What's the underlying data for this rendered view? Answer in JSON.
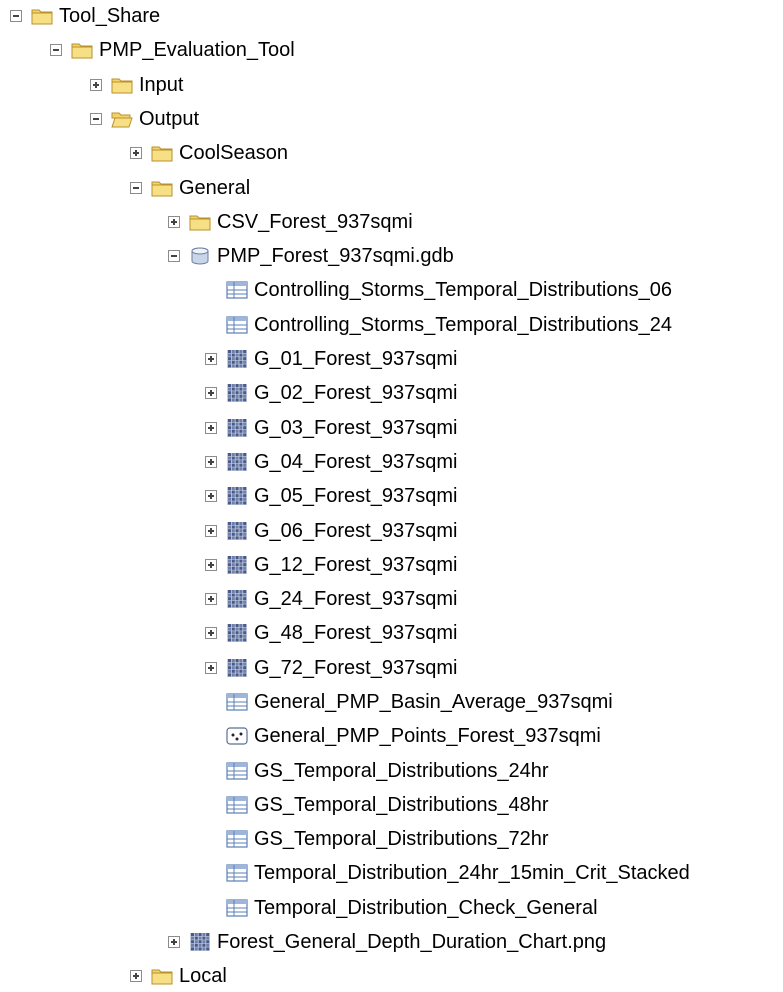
{
  "tree": {
    "partial_top_item": "Tool_Share",
    "items": [
      {
        "label": "Tool_Share",
        "icon": "folder-icon",
        "toggle": "minus"
      },
      {
        "label": "PMP_Evaluation_Tool",
        "icon": "folder-icon",
        "toggle": "minus"
      },
      {
        "label": "Input",
        "icon": "folder-icon",
        "toggle": "plus"
      },
      {
        "label": "Output",
        "icon": "folder-open-icon",
        "toggle": "minus"
      },
      {
        "label": "CoolSeason",
        "icon": "folder-icon",
        "toggle": "plus"
      },
      {
        "label": "General",
        "icon": "folder-icon",
        "toggle": "minus"
      },
      {
        "label": "CSV_Forest_937sqmi",
        "icon": "folder-icon",
        "toggle": "plus"
      },
      {
        "label": "PMP_Forest_937sqmi.gdb",
        "icon": "geodatabase-icon",
        "toggle": "minus"
      },
      {
        "label": "Controlling_Storms_Temporal_Distributions_06",
        "icon": "table-icon",
        "toggle": "none"
      },
      {
        "label": "Controlling_Storms_Temporal_Distributions_24",
        "icon": "table-icon",
        "toggle": "none"
      },
      {
        "label": "G_01_Forest_937sqmi",
        "icon": "raster-icon",
        "toggle": "plus"
      },
      {
        "label": "G_02_Forest_937sqmi",
        "icon": "raster-icon",
        "toggle": "plus"
      },
      {
        "label": "G_03_Forest_937sqmi",
        "icon": "raster-icon",
        "toggle": "plus"
      },
      {
        "label": "G_04_Forest_937sqmi",
        "icon": "raster-icon",
        "toggle": "plus"
      },
      {
        "label": "G_05_Forest_937sqmi",
        "icon": "raster-icon",
        "toggle": "plus"
      },
      {
        "label": "G_06_Forest_937sqmi",
        "icon": "raster-icon",
        "toggle": "plus"
      },
      {
        "label": "G_12_Forest_937sqmi",
        "icon": "raster-icon",
        "toggle": "plus"
      },
      {
        "label": "G_24_Forest_937sqmi",
        "icon": "raster-icon",
        "toggle": "plus"
      },
      {
        "label": "G_48_Forest_937sqmi",
        "icon": "raster-icon",
        "toggle": "plus"
      },
      {
        "label": "G_72_Forest_937sqmi",
        "icon": "raster-icon",
        "toggle": "plus"
      },
      {
        "label": "General_PMP_Basin_Average_937sqmi",
        "icon": "table-icon",
        "toggle": "none"
      },
      {
        "label": "General_PMP_Points_Forest_937sqmi",
        "icon": "point-feature-class-icon",
        "toggle": "none"
      },
      {
        "label": "GS_Temporal_Distributions_24hr",
        "icon": "table-icon",
        "toggle": "none"
      },
      {
        "label": "GS_Temporal_Distributions_48hr",
        "icon": "table-icon",
        "toggle": "none"
      },
      {
        "label": "GS_Temporal_Distributions_72hr",
        "icon": "table-icon",
        "toggle": "none"
      },
      {
        "label": "Temporal_Distribution_24hr_15min_Crit_Stacked",
        "icon": "table-icon",
        "toggle": "none"
      },
      {
        "label": "Temporal_Distribution_Check_General",
        "icon": "table-icon",
        "toggle": "none"
      },
      {
        "label": "Forest_General_Depth_Duration_Chart.png",
        "icon": "raster-icon",
        "toggle": "plus"
      },
      {
        "label": "Local",
        "icon": "folder-icon",
        "toggle": "plus"
      }
    ]
  },
  "colors": {
    "folder": "#f2d36b",
    "folder_edge": "#b8912a",
    "table": "#5b7fb5",
    "raster": "#4a5a85"
  }
}
